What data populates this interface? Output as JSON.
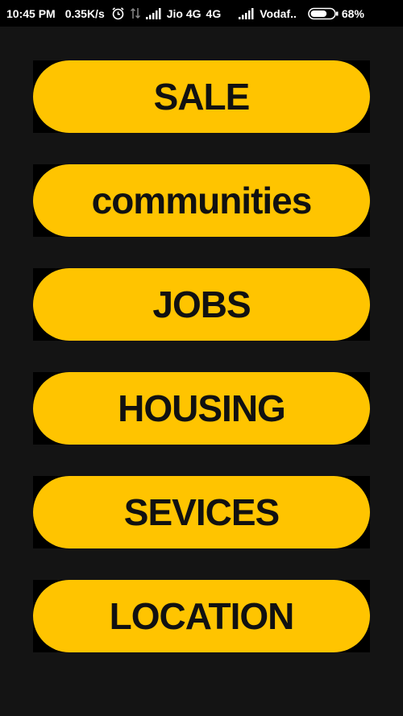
{
  "status_bar": {
    "time": "10:45 PM",
    "speed": "0.35K/s",
    "carrier1": "Jio 4G",
    "network_type": "4G",
    "carrier2": "Vodaf..",
    "battery": "68%",
    "battery_level": 0.68,
    "icons": [
      "alarm-icon",
      "data-transfer-icon",
      "signal-icon",
      "signal-icon",
      "battery-icon"
    ]
  },
  "menu": {
    "items": [
      {
        "label": "SALE"
      },
      {
        "label": "communities"
      },
      {
        "label": "JOBS"
      },
      {
        "label": "HOUSING"
      },
      {
        "label": "SEVICES"
      },
      {
        "label": "LOCATION"
      }
    ]
  },
  "colors": {
    "background": "#141414",
    "button": "#FFC400",
    "button_text": "#111111",
    "status_bar": "#000000"
  }
}
